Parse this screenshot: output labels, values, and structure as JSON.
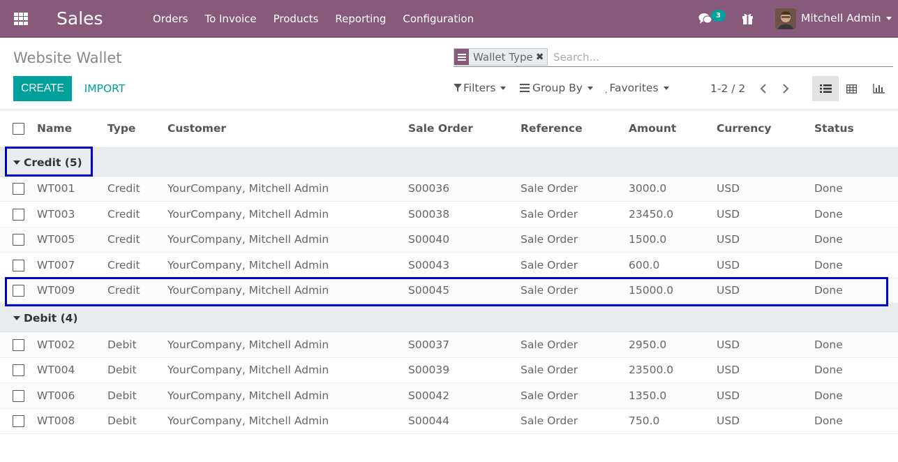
{
  "navbar": {
    "app_name": "Sales",
    "menu": [
      "Orders",
      "To Invoice",
      "Products",
      "Reporting",
      "Configuration"
    ],
    "chat_count": "3",
    "user_name": "Mitchell Admin",
    "icons": [
      "apps-grid-icon",
      "chat-icon",
      "gift-icon"
    ],
    "color": "#875a7b"
  },
  "control_panel": {
    "title": "Website Wallet",
    "create_label": "CREATE",
    "import_label": "IMPORT",
    "search": {
      "facet_value": "Wallet Type",
      "placeholder": "Search..."
    },
    "filters_label": "Filters",
    "group_by_label": "Group By",
    "favorites_label": "Favorites",
    "pager": "1-2 / 2",
    "views": [
      "list-view-icon",
      "pivot-view-icon",
      "graph-view-icon"
    ],
    "accent": "#00a09d"
  },
  "list": {
    "columns": [
      "Name",
      "Type",
      "Customer",
      "Sale Order",
      "Reference",
      "Amount",
      "Currency",
      "Status"
    ],
    "groups": [
      {
        "label": "Credit (5)",
        "rows": [
          [
            "WT001",
            "Credit",
            "YourCompany, Mitchell Admin",
            "S00036",
            "Sale Order",
            "3000.0",
            "USD",
            "Done"
          ],
          [
            "WT003",
            "Credit",
            "YourCompany, Mitchell Admin",
            "S00038",
            "Sale Order",
            "23450.0",
            "USD",
            "Done"
          ],
          [
            "WT005",
            "Credit",
            "YourCompany, Mitchell Admin",
            "S00040",
            "Sale Order",
            "1500.0",
            "USD",
            "Done"
          ],
          [
            "WT007",
            "Credit",
            "YourCompany, Mitchell Admin",
            "S00043",
            "Sale Order",
            "600.0",
            "USD",
            "Done"
          ],
          [
            "WT009",
            "Credit",
            "YourCompany, Mitchell Admin",
            "S00045",
            "Sale Order",
            "15000.0",
            "USD",
            "Done"
          ]
        ]
      },
      {
        "label": "Debit (4)",
        "rows": [
          [
            "WT002",
            "Debit",
            "YourCompany, Mitchell Admin",
            "S00037",
            "Sale Order",
            "2950.0",
            "USD",
            "Done"
          ],
          [
            "WT004",
            "Debit",
            "YourCompany, Mitchell Admin",
            "S00039",
            "Sale Order",
            "23500.0",
            "USD",
            "Done"
          ],
          [
            "WT006",
            "Debit",
            "YourCompany, Mitchell Admin",
            "S00042",
            "Sale Order",
            "1350.0",
            "USD",
            "Done"
          ],
          [
            "WT008",
            "Debit",
            "YourCompany, Mitchell Admin",
            "S00044",
            "Sale Order",
            "750.0",
            "USD",
            "Done"
          ]
        ]
      }
    ],
    "highlight_color": "#0000cc"
  }
}
